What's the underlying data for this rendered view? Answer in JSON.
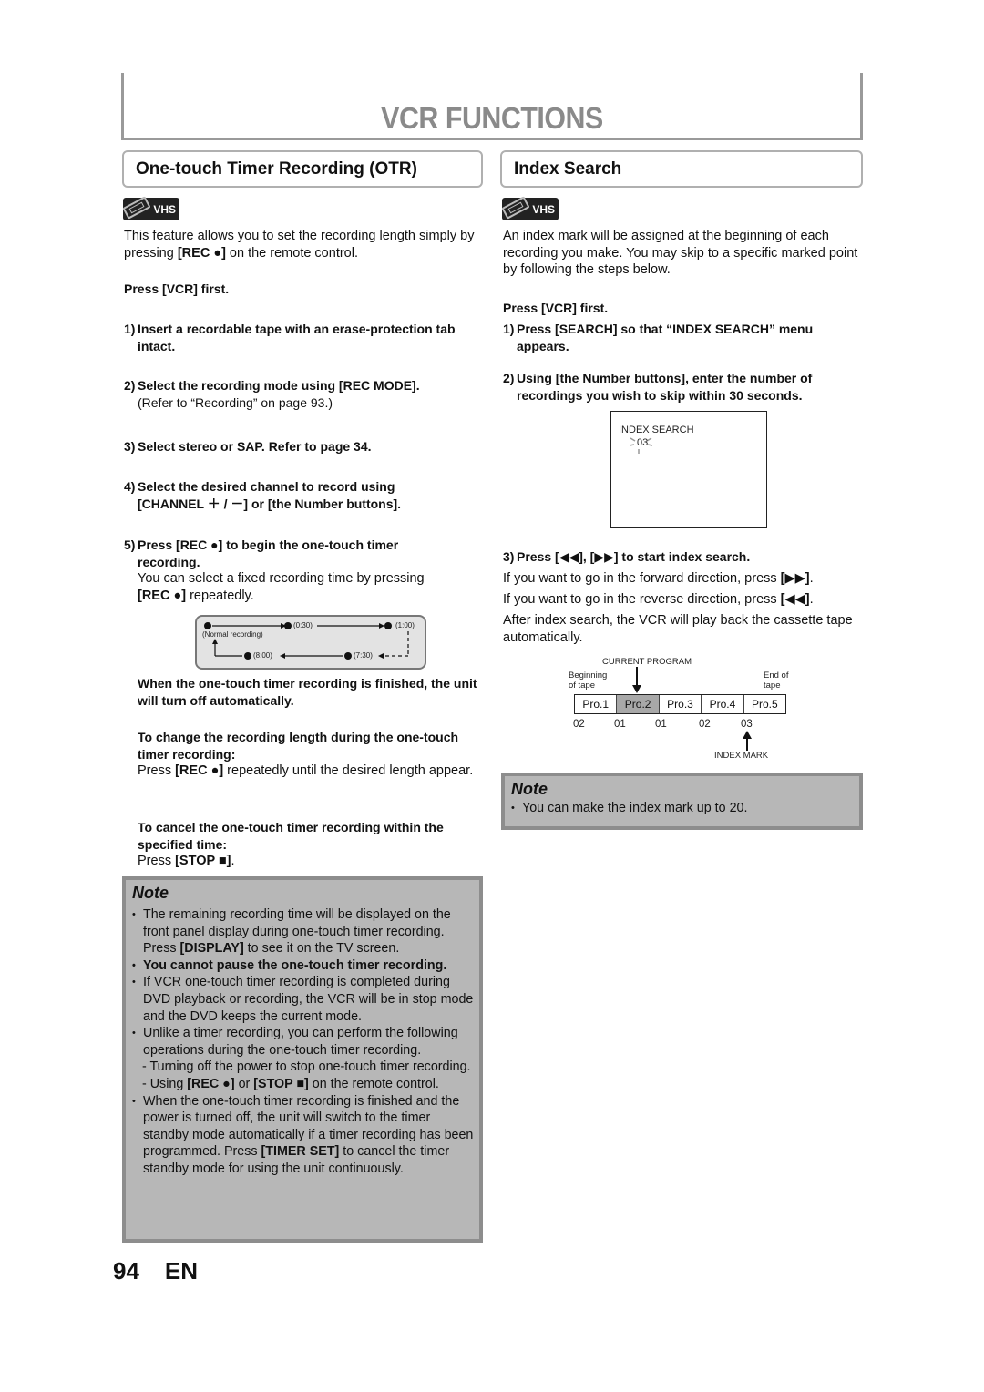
{
  "page": {
    "title": "VCR FUNCTIONS",
    "page_number": "94",
    "language": "EN"
  },
  "otr": {
    "heading": "One-touch Timer Recording (OTR)",
    "badge": "VHS",
    "intro_a": "This feature allows you to set the recording length simply by pressing ",
    "intro_key": "[REC ●]",
    "intro_b": " on the remote control.",
    "press_first": "Press [VCR] first.",
    "steps": [
      {
        "num": "1)",
        "text": "Insert a recordable tape with an erase-protection tab intact."
      },
      {
        "num": "2)",
        "text": "Select the recording mode using [REC MODE].",
        "sub": "(Refer to “Recording” on page 93.)"
      },
      {
        "num": "3)",
        "text": "Select stereo or SAP. Refer to page 34."
      },
      {
        "num": "4)",
        "text": "Select the desired channel to record using [CHANNEL ＋ / －] or [the Number buttons]."
      },
      {
        "num": "5)",
        "text": "Press [REC ●] to begin the one-touch timer recording.",
        "sub_a": "You can select a fixed recording time by pressing ",
        "sub_key": "[REC ●]",
        "sub_b": " repeatedly."
      }
    ],
    "diagram": {
      "normal": "(Normal recording)",
      "t1": "(0:30)",
      "t2": "(1:00)",
      "t3": "(7:30)",
      "t4": "(8:00)"
    },
    "finished": "When the one-touch timer recording is finished, the unit will turn off automatically.",
    "change_heading": "To change the recording length during the one-touch timer recording:",
    "change_a": "Press ",
    "change_key": "[REC ●]",
    "change_b": " repeatedly until the desired length appear.",
    "cancel_heading": "To cancel the one-touch timer recording within the specified time:",
    "cancel_a": "Press ",
    "cancel_key": "[STOP ■]",
    "cancel_b": ".",
    "note": {
      "title": "Note",
      "item1_a": "The remaining recording time will be displayed on the front panel display during one-touch timer recording. Press ",
      "item1_key": "[DISPLAY]",
      "item1_b": " to see it on the TV screen.",
      "item2": "You cannot pause the one-touch timer recording.",
      "item3": "If VCR one-touch timer recording is completed during DVD playback or recording, the VCR will be in stop mode and the DVD keeps the current mode.",
      "item4": "Unlike a timer recording, you can perform the following operations during the one-touch timer recording.",
      "dash1": "- Turning off the power to stop one-touch timer recording.",
      "dash2_a": "- Using ",
      "dash2_key1": "[REC ●]",
      "dash2_mid": " or ",
      "dash2_key2": "[STOP ■]",
      "dash2_b": " on the remote control.",
      "item5_a": "When the one-touch timer recording is finished and the power is turned off, the unit will switch to the timer standby mode automatically if a timer recording has been programmed. Press ",
      "item5_key": "[TIMER SET]",
      "item5_b": " to cancel the timer standby mode for using the unit continuously."
    }
  },
  "index": {
    "heading": "Index Search",
    "badge": "VHS",
    "intro": "An index mark will be assigned at the beginning of each recording you make. You may skip to a specific marked point by following the steps below.",
    "press_first": "Press [VCR] first.",
    "steps": [
      {
        "num": "1)",
        "text": "Press [SEARCH] so that “INDEX SEARCH” menu appears."
      },
      {
        "num": "2)",
        "text": "Using [the Number buttons], enter the number of recordings you wish to skip within 30 seconds."
      },
      {
        "num": "3)",
        "text": "Press [◀◀], [▶▶] to start index search."
      }
    ],
    "screen": {
      "title": "INDEX SEARCH",
      "value": "03"
    },
    "forward_a": "If you want to go in the forward direction, press ",
    "forward_key": "[▶▶]",
    "forward_b": ".",
    "reverse_a": "If you want to go in the reverse direction, press ",
    "reverse_key": "[◀◀]",
    "reverse_b": ".",
    "after": "After index search, the VCR will play back the cassette tape automatically.",
    "tape_diagram": {
      "current_label": "CURRENT PROGRAM",
      "beginning": "Beginning of tape",
      "end": "End of tape",
      "programs": [
        "Pro.1",
        "Pro.2",
        "Pro.3",
        "Pro.4",
        "Pro.5"
      ],
      "current_index": 1,
      "marks": [
        "02",
        "01",
        "01",
        "02",
        "03"
      ],
      "index_mark_label": "INDEX MARK"
    },
    "note": {
      "title": "Note",
      "item1": "You can make the index mark up to 20."
    }
  }
}
